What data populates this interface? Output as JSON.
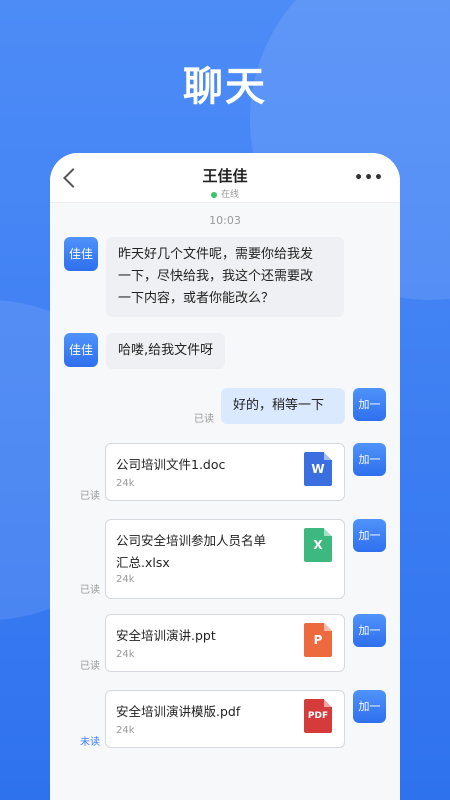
{
  "hero": {
    "title": "聊天"
  },
  "chat": {
    "contact_name": "王佳佳",
    "status": "在线",
    "more": "•••",
    "timestamp": "10:03",
    "avatar_in": "佳佳",
    "avatar_out": "加一"
  },
  "messages": [
    {
      "direction": "in",
      "text_lines": [
        "昨天好几个文件呢，需要你给我发",
        "一下，尽快给我，我这个还需要改",
        "一下内容，或者你能改么？"
      ]
    },
    {
      "direction": "in",
      "text_lines": [
        "哈喽,给我文件呀"
      ]
    },
    {
      "direction": "out",
      "text": "好的，稍等一下",
      "state": "已读"
    }
  ],
  "files": [
    {
      "name_lines": [
        "公司培训文件1.doc"
      ],
      "size": "24k",
      "icon_label": "W",
      "icon_color": "#3b6fe0",
      "state": "已读"
    },
    {
      "name_lines": [
        "公司安全培训参加人员名单",
        "汇总.xlsx"
      ],
      "size": "24k",
      "icon_label": "X",
      "icon_color": "#3db87e",
      "state": "已读"
    },
    {
      "name_lines": [
        "安全培训演讲.ppt"
      ],
      "size": "24k",
      "icon_label": "P",
      "icon_color": "#ec6a3d",
      "state": "已读"
    },
    {
      "name_lines": [
        "安全培训演讲模版.pdf"
      ],
      "size": "24k",
      "icon_label": "PDF",
      "icon_color": "#d63b3b",
      "state": "未读"
    }
  ]
}
